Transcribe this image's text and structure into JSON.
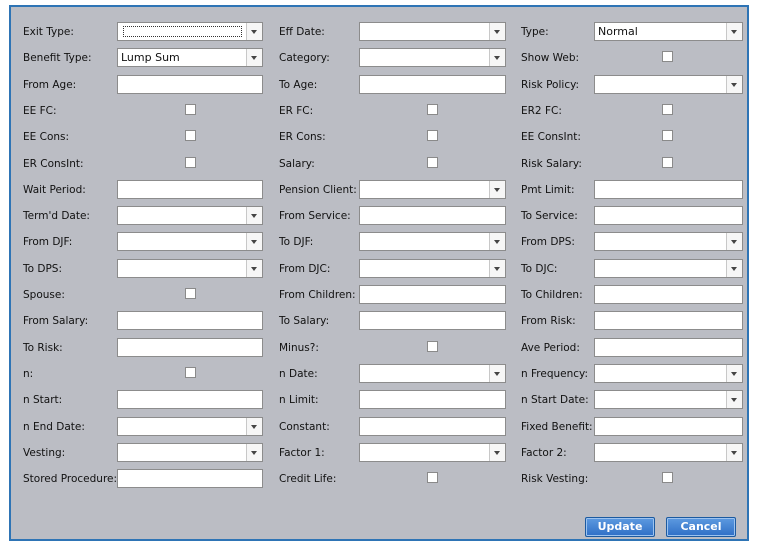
{
  "form": {
    "col1": [
      {
        "label": "Exit Type:",
        "type": "dropdown",
        "value": ""
      },
      {
        "label": "Benefit Type:",
        "type": "dropdown",
        "value": "Lump Sum"
      },
      {
        "label": "From Age:",
        "type": "text",
        "value": ""
      },
      {
        "label": "EE FC:",
        "type": "checkbox",
        "checked": false
      },
      {
        "label": "EE Cons:",
        "type": "checkbox",
        "checked": false
      },
      {
        "label": "ER ConsInt:",
        "type": "checkbox",
        "checked": false
      },
      {
        "label": "Wait Period:",
        "type": "text",
        "value": ""
      },
      {
        "label": "Term'd Date:",
        "type": "dropdown",
        "value": ""
      },
      {
        "label": "From DJF:",
        "type": "dropdown",
        "value": ""
      },
      {
        "label": "To DPS:",
        "type": "dropdown",
        "value": ""
      },
      {
        "label": "Spouse:",
        "type": "checkbox",
        "checked": false
      },
      {
        "label": "From Salary:",
        "type": "text",
        "value": ""
      },
      {
        "label": "To Risk:",
        "type": "text",
        "value": ""
      },
      {
        "label": "n:",
        "type": "checkbox",
        "checked": false
      },
      {
        "label": "n Start:",
        "type": "text",
        "value": ""
      },
      {
        "label": "n End Date:",
        "type": "dropdown",
        "value": ""
      },
      {
        "label": "Vesting:",
        "type": "dropdown",
        "value": ""
      },
      {
        "label": "Stored Procedure:",
        "type": "text",
        "value": ""
      }
    ],
    "col2": [
      {
        "label": "Eff Date:",
        "type": "dropdown",
        "value": ""
      },
      {
        "label": "Category:",
        "type": "dropdown",
        "value": ""
      },
      {
        "label": "To Age:",
        "type": "text",
        "value": ""
      },
      {
        "label": "ER FC:",
        "type": "checkbox",
        "checked": false
      },
      {
        "label": "ER Cons:",
        "type": "checkbox",
        "checked": false
      },
      {
        "label": "Salary:",
        "type": "checkbox",
        "checked": false
      },
      {
        "label": "Pension Client:",
        "type": "dropdown",
        "value": ""
      },
      {
        "label": "From Service:",
        "type": "text",
        "value": ""
      },
      {
        "label": "To DJF:",
        "type": "dropdown",
        "value": ""
      },
      {
        "label": "From DJC:",
        "type": "dropdown",
        "value": ""
      },
      {
        "label": "From Children:",
        "type": "text",
        "value": ""
      },
      {
        "label": "To Salary:",
        "type": "text",
        "value": ""
      },
      {
        "label": "Minus?:",
        "type": "checkbox",
        "checked": false
      },
      {
        "label": "n Date:",
        "type": "dropdown",
        "value": ""
      },
      {
        "label": "n Limit:",
        "type": "text",
        "value": ""
      },
      {
        "label": "Constant:",
        "type": "text",
        "value": ""
      },
      {
        "label": "Factor 1:",
        "type": "dropdown",
        "value": ""
      },
      {
        "label": "Credit Life:",
        "type": "checkbox",
        "checked": false
      }
    ],
    "col3": [
      {
        "label": "Type:",
        "type": "dropdown",
        "value": "Normal"
      },
      {
        "label": "Show Web:",
        "type": "checkbox",
        "checked": false
      },
      {
        "label": "Risk Policy:",
        "type": "dropdown",
        "value": ""
      },
      {
        "label": "ER2 FC:",
        "type": "checkbox",
        "checked": false
      },
      {
        "label": "EE ConsInt:",
        "type": "checkbox",
        "checked": false
      },
      {
        "label": "Risk Salary:",
        "type": "checkbox",
        "checked": false
      },
      {
        "label": "Pmt Limit:",
        "type": "text",
        "value": ""
      },
      {
        "label": "To Service:",
        "type": "text",
        "value": ""
      },
      {
        "label": "From DPS:",
        "type": "dropdown",
        "value": ""
      },
      {
        "label": "To DJC:",
        "type": "dropdown",
        "value": ""
      },
      {
        "label": "To Children:",
        "type": "text",
        "value": ""
      },
      {
        "label": "From Risk:",
        "type": "text",
        "value": ""
      },
      {
        "label": "Ave Period:",
        "type": "text",
        "value": ""
      },
      {
        "label": "n Frequency:",
        "type": "dropdown",
        "value": ""
      },
      {
        "label": "n Start Date:",
        "type": "dropdown",
        "value": ""
      },
      {
        "label": "Fixed Benefit:",
        "type": "text",
        "value": ""
      },
      {
        "label": "Factor 2:",
        "type": "dropdown",
        "value": ""
      },
      {
        "label": "Risk Vesting:",
        "type": "checkbox",
        "checked": false
      }
    ]
  },
  "buttons": {
    "update": "Update",
    "cancel": "Cancel"
  },
  "colors": {
    "panel": "#bbbdc4",
    "border": "#2e74b5",
    "button": "#2f6fc6"
  }
}
